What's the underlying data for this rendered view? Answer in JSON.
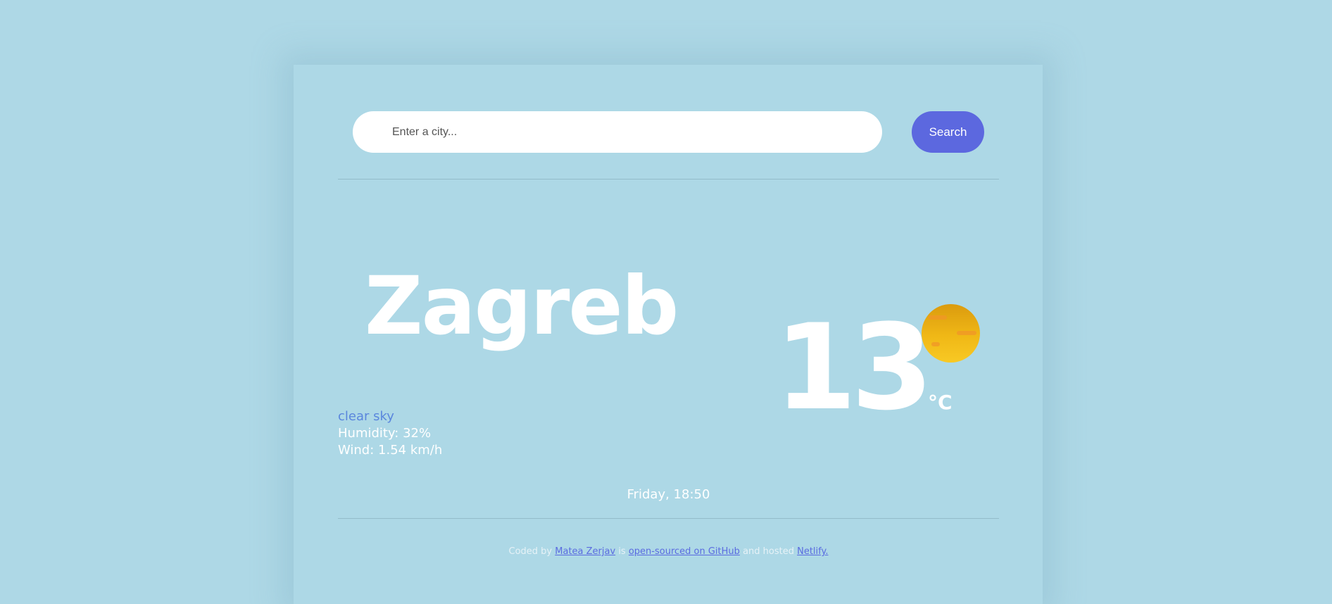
{
  "search": {
    "placeholder": "Enter a city...",
    "button_label": "Search"
  },
  "weather": {
    "city": "Zagreb",
    "temperature": "13",
    "unit": "°C",
    "description": "clear sky",
    "humidity": "Humidity: 32%",
    "wind": "Wind: 1.54 km/h",
    "datetime": "Friday, 18:50",
    "icon": "sun-icon"
  },
  "footer": {
    "prefix": "Coded by",
    "author_link": "Matea Zerjav",
    "middle": "is",
    "github_link": "open-sourced on GitHub",
    "hosted_text": "and hosted",
    "netlify_link": "Netlify."
  },
  "colors": {
    "background": "#add8e6",
    "accent": "#5c68df",
    "description": "#5a86dd",
    "sun": "#f0b816"
  }
}
